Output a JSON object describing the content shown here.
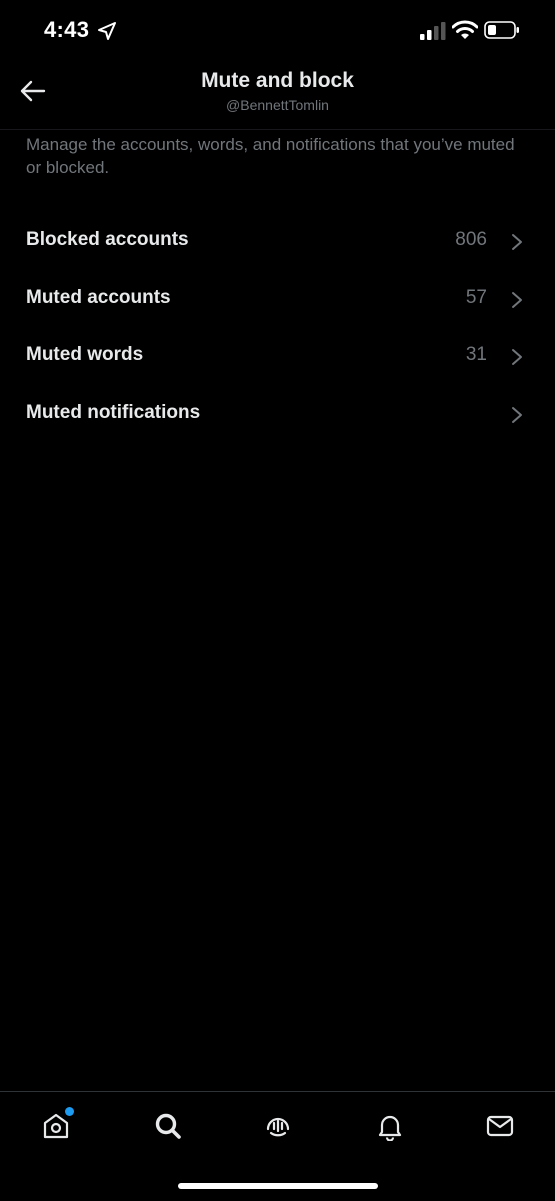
{
  "status_bar": {
    "time": "4:43",
    "icons": [
      "location-arrow-icon",
      "cellular-signal-icon",
      "wifi-icon",
      "battery-icon"
    ]
  },
  "header": {
    "title": "Mute and block",
    "subtitle": "@BennettTomlin",
    "back_icon": "arrow-left-icon"
  },
  "description": "Manage the accounts, words, and notifications that you’ve muted or blocked.",
  "menu": {
    "items": [
      {
        "label": "Blocked accounts",
        "count": "806"
      },
      {
        "label": "Muted accounts",
        "count": "57"
      },
      {
        "label": "Muted words",
        "count": "31"
      },
      {
        "label": "Muted notifications",
        "count": ""
      }
    ]
  },
  "tab_bar": {
    "tabs": [
      {
        "icon": "home-icon",
        "has_badge": true
      },
      {
        "icon": "search-icon",
        "selected": true
      },
      {
        "icon": "spaces-icon"
      },
      {
        "icon": "bell-icon"
      },
      {
        "icon": "mail-icon"
      }
    ]
  },
  "colors": {
    "background": "#000000",
    "primary_text": "#e7e9ea",
    "secondary_text": "#71767b",
    "accent": "#1d9bf0"
  }
}
